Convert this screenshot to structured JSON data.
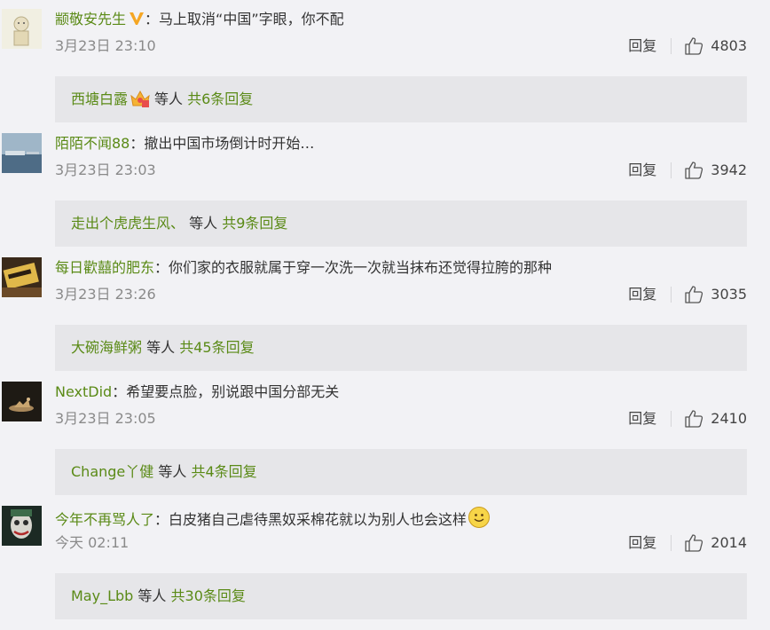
{
  "comments": [
    {
      "username": "颛敬安先生",
      "text": "马上取消“中国”字眼，你不配",
      "time": "3月23日 23:10",
      "reply_label": "回复",
      "likes": "4803",
      "sub": {
        "user": "西塘白露",
        "deng": "等人",
        "total": "共6条回复"
      }
    },
    {
      "username": "陌陌不闻88",
      "text": "撤出中国市场倒计时开始…",
      "time": "3月23日 23:03",
      "reply_label": "回复",
      "likes": "3942",
      "sub": {
        "user": "走出个虎虎生风、",
        "deng": "等人",
        "total": "共9条回复"
      }
    },
    {
      "username": "每日歡囍的肥东",
      "text": "你们家的衣服就属于穿一次洗一次就当抹布还觉得拉胯的那种",
      "time": "3月23日 23:26",
      "reply_label": "回复",
      "likes": "3035",
      "sub": {
        "user": "大碗海鲜粥",
        "deng": "等人",
        "total": "共45条回复"
      }
    },
    {
      "username": "NextDid",
      "text": "希望要点脸，别说跟中国分部无关",
      "time": "3月23日 23:05",
      "reply_label": "回复",
      "likes": "2410",
      "sub": {
        "user": "Change丫健",
        "deng": "等人",
        "total": "共4条回复"
      }
    },
    {
      "username": "今年不再骂人了",
      "text": "白皮猪自己虐待黑奴采棉花就以为别人也会这样",
      "time": "今天 02:11",
      "reply_label": "回复",
      "likes": "2014",
      "sub": {
        "user": "May_Lbb",
        "deng": "等人",
        "total": "共30条回复"
      }
    }
  ],
  "colors": {
    "username": "#5a8a16",
    "background": "#f2f2f5",
    "reply_box": "#e6e6e9",
    "time": "#8a8a8a"
  },
  "separator": "："
}
